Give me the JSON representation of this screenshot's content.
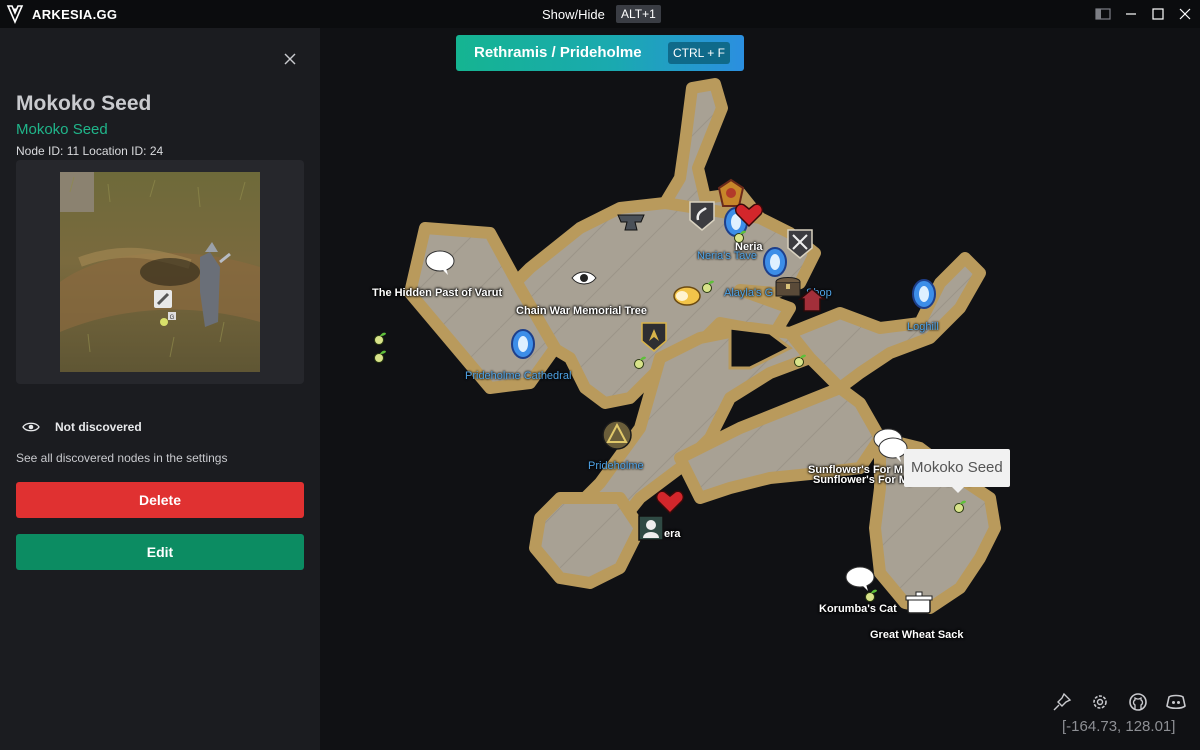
{
  "app": {
    "name": "ARKESIA.GG",
    "show_hide_label": "Show/Hide",
    "show_hide_shortcut": "ALT+1"
  },
  "colors": {
    "accent_green": "#0c8c62",
    "danger_red": "#e03131",
    "subtitle_green": "#20b58a",
    "label_blue": "#4fa3e6",
    "map_land": "#a8a194",
    "map_border": "#b99a5c"
  },
  "panel": {
    "title": "Mokoko Seed",
    "subtitle": "Mokoko Seed",
    "ids_text": "Node ID: 11 Location ID: 24",
    "image_badge": "G",
    "discovered_label": "Not discovered",
    "settings_hint": "See all discovered nodes in the settings",
    "delete_label": "Delete",
    "edit_label": "Edit"
  },
  "map": {
    "breadcrumb": {
      "text": "Rethramis  /  Prideholme",
      "shortcut": "CTRL + F"
    },
    "tooltip": "Mokoko Seed",
    "labels": {
      "hidden_past": "The Hidden Past of Varut",
      "memorial": "Chain War Memorial Tree",
      "cathedral": "Prideholme Cathedral",
      "prideholme": "Prideholme",
      "nerias_tavern": "Neria's Tave",
      "neria": "Neria",
      "alayla": "Alayla's G",
      "alayla_suffix": "Shop",
      "loghill": "Loghill",
      "sunflower1": "Sunflower's For M",
      "sunflower2": "Sunflower's For My Love (Jan)",
      "neria_lower": "era",
      "korumba": "Korumba's Cat",
      "wheat": "Great Wheat Sack"
    },
    "icons": [
      "speech-bubble-icon",
      "eye-icon",
      "anvil-icon",
      "horn-shield-icon",
      "teleport-portal-icon",
      "heart-icon",
      "crossed-swords-shield-icon",
      "chest-icon",
      "house-icon",
      "bread-icon",
      "mokoko-seed-icon",
      "triforce-icon",
      "bust-icon",
      "cooking-pot-icon",
      "boss-crest-icon"
    ],
    "coords": "[-164.73, 128.01]"
  },
  "toolbar": {
    "icons": [
      "pin-icon",
      "gear-icon",
      "github-icon",
      "discord-icon"
    ]
  }
}
